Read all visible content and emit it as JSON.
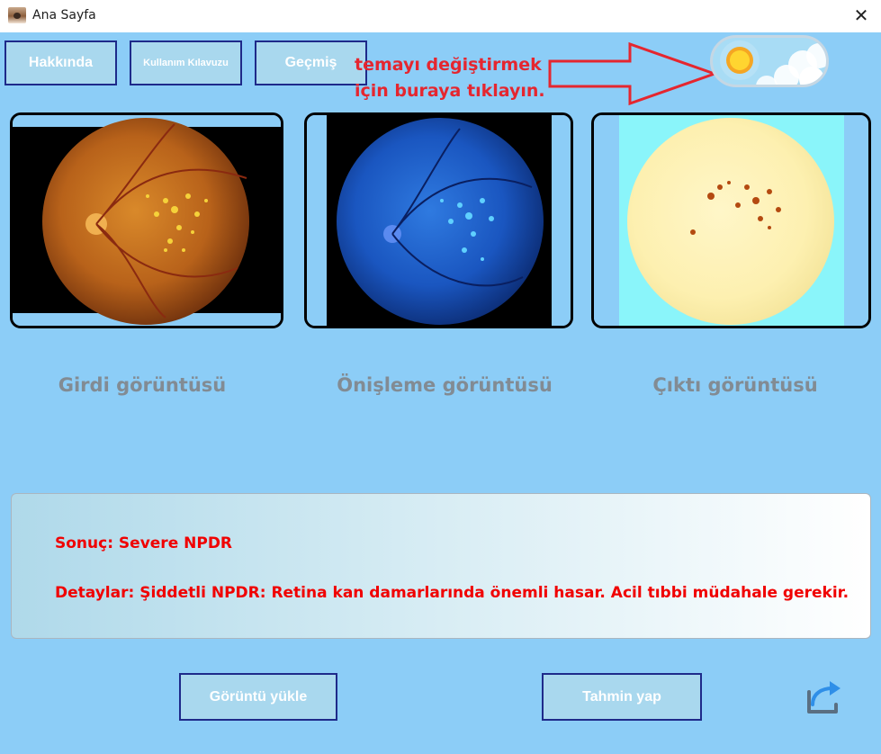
{
  "window": {
    "title": "Ana Sayfa",
    "close_label": "✕",
    "icon": "eye-icon"
  },
  "toolbar": {
    "about_label": "Hakkında",
    "guide_label": "Kullanım Kılavuzu",
    "history_label": "Geçmiş"
  },
  "theme_hint": {
    "line1": "temayı değiştirmek",
    "line2": "için buraya tıklayın.",
    "color": "#e5262f"
  },
  "theme_toggle": {
    "icon": "sun-icon",
    "state": "light"
  },
  "images": {
    "input_caption": "Girdi görüntüsü",
    "preprocess_caption": "Önişleme görüntüsü",
    "output_caption": "Çıktı görüntüsü"
  },
  "result": {
    "summary": "Sonuç: Severe NPDR",
    "details": "Detaylar: Şiddetli NPDR: Retina kan damarlarında önemli hasar. Acil tıbbi müdahale gerekir.",
    "color": "#f00000"
  },
  "actions": {
    "load_label": "Görüntü yükle",
    "predict_label": "Tahmin yap",
    "share_icon": "share-icon"
  },
  "colors": {
    "background": "#8ccdf7",
    "button_fill": "#a9d8ee",
    "button_border": "#1e2a8a",
    "caption": "#828b93"
  }
}
